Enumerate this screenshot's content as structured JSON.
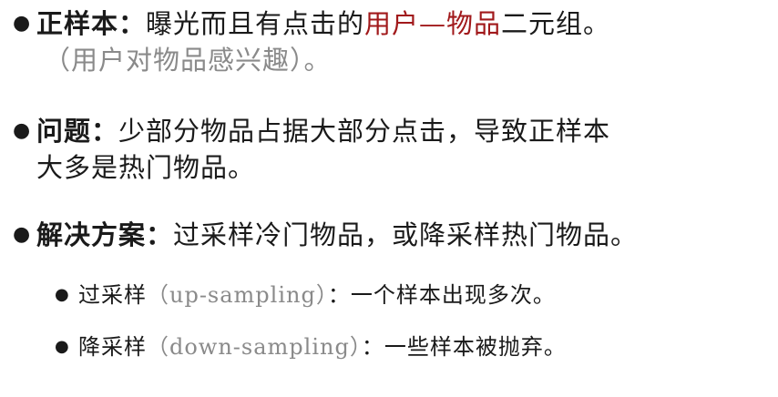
{
  "bullets": [
    {
      "term": "正样本：",
      "text_before": "曝光而且有点击的",
      "highlight": "用户—物品",
      "text_after": "二元组。",
      "note": "（用户对物品感兴趣）。"
    },
    {
      "term": "问题：",
      "line1": "少部分物品占据大部分点击，导致正样本",
      "line2": "大多是热门物品。"
    },
    {
      "term": "解决方案：",
      "text": "过采样冷门物品，或降采样热门物品。"
    }
  ],
  "sub_bullets": [
    {
      "term": "过采样",
      "latin": "（up-sampling）",
      "text": "：一个样本出现多次。"
    },
    {
      "term": "降采样",
      "latin": "（down-sampling）",
      "text": "：一些样本被抛弃。"
    }
  ],
  "colors": {
    "highlight": "#a1191b",
    "note": "#8a8a8a"
  }
}
